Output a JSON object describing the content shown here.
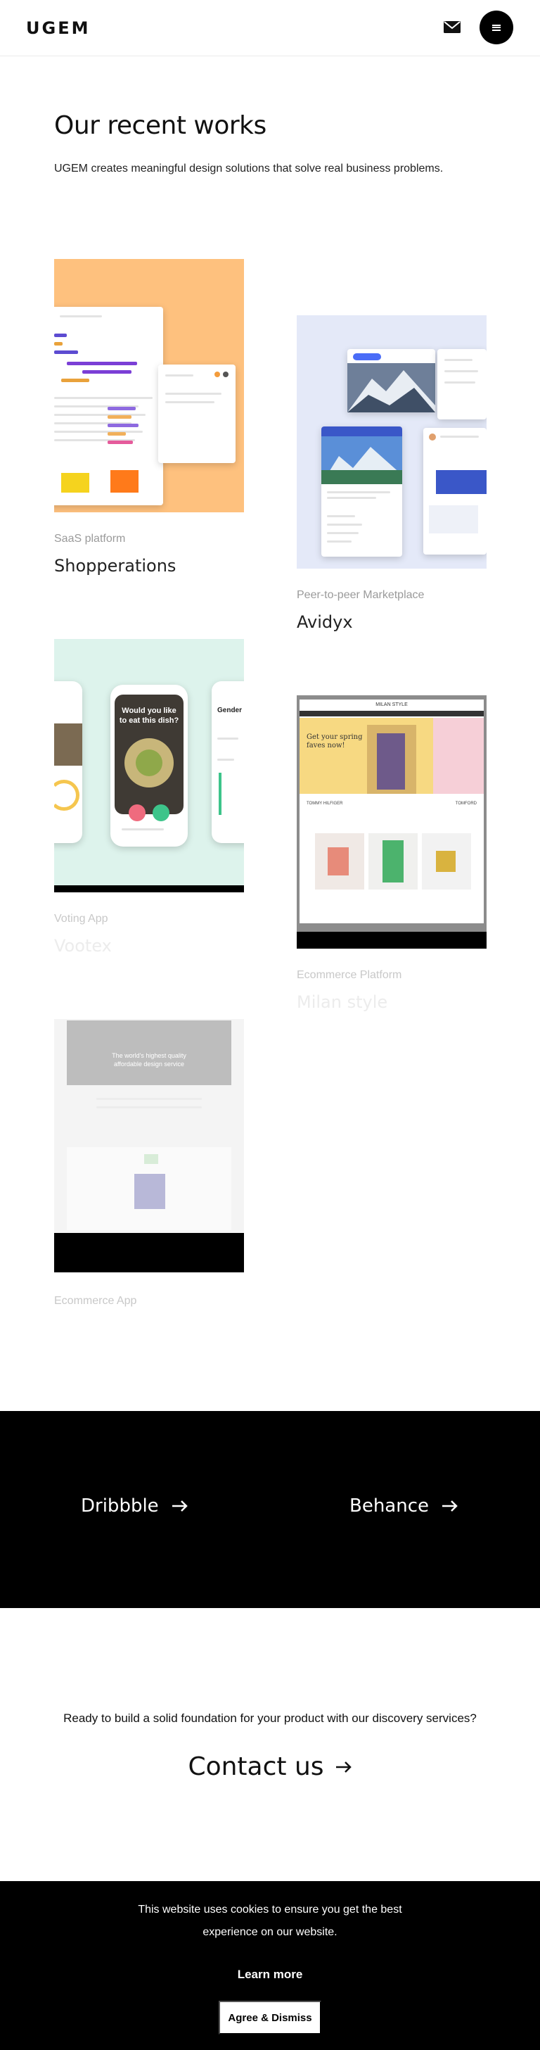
{
  "header": {
    "logo": "UGEM",
    "mail_icon": "mail-icon",
    "menu_icon": "menu-icon"
  },
  "intro": {
    "title": "Our recent works",
    "text": "UGEM creates meaningful design solutions that solve real business problems."
  },
  "projects": [
    {
      "category": "SaaS platform",
      "name": "Shopperations",
      "thumb_bg": "#fec17e"
    },
    {
      "category": "Peer-to-peer Marketplace",
      "name": "Avidyx",
      "thumb_bg": "#e4e9f8"
    },
    {
      "category": "Voting App",
      "name": "Vootex",
      "thumb_bg": "#ddf3ec"
    },
    {
      "category": "Ecommerce Platform",
      "name": "Milan style",
      "thumb_bg": "#8c8c8c"
    },
    {
      "category": "Ecommerce App",
      "name": "",
      "thumb_bg": "#f4f4f4"
    }
  ],
  "mockups": {
    "voting_question": "Would you like to eat this dish?",
    "voting_side_label": "Gender",
    "milan_brand": "MILAN STYLE",
    "milan_headline": "Get your spring faves now!",
    "milan_brands": [
      "TOMMY HILFIGER",
      "TOMFORD"
    ],
    "ecom_headline": "The world's highest quality affordable design service"
  },
  "links": {
    "dribbble": "Dribbble",
    "behance": "Behance",
    "arrow": "arrow-right-icon"
  },
  "contact": {
    "lead": "Ready to build a solid foundation for your product with our discovery services?",
    "link": "Contact us"
  },
  "cookie": {
    "text": "This website uses cookies to ensure you get the best experience on our website.",
    "learn_more": "Learn more",
    "agree": "Agree & Dismiss"
  },
  "colors": {
    "background": "#ffffff",
    "dark": "#000000",
    "muted_text": "#9a9a9a"
  }
}
